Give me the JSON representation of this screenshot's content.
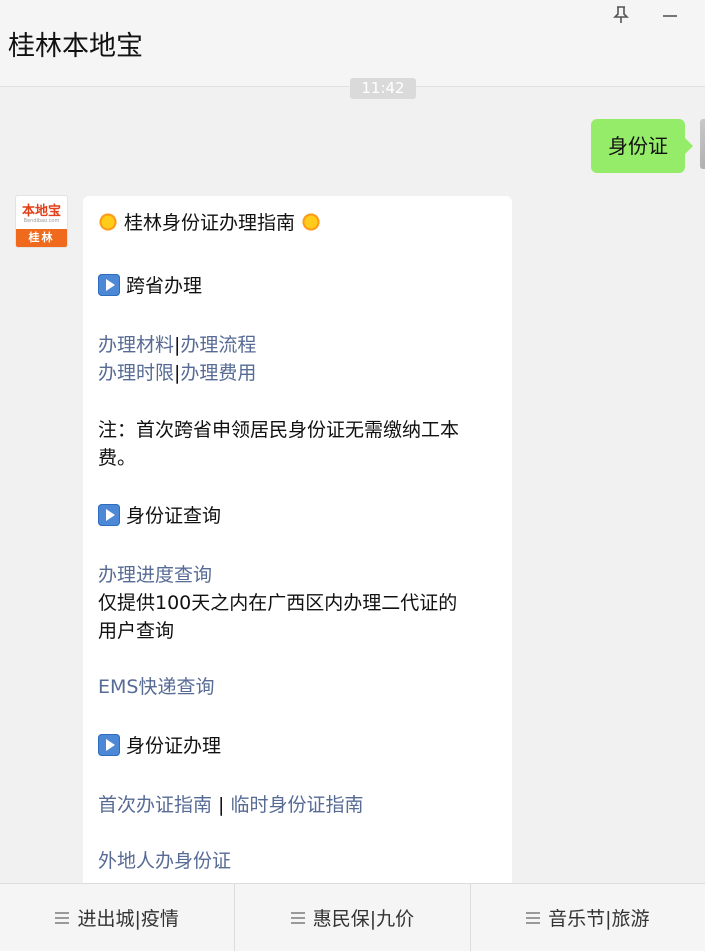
{
  "window": {
    "title": "桂林本地宝"
  },
  "chat": {
    "time": "11:42",
    "user_message": "身份证",
    "bot_avatar": {
      "logo_text": "本地宝",
      "logo_url": "Bendibao.com",
      "city": "桂林"
    },
    "bot_message": {
      "heading": "桂林身份证办理指南",
      "sec1_title": "跨省办理",
      "link_materials": "办理材料",
      "link_process": "办理流程",
      "link_time": "办理时限",
      "link_fee": "办理费用",
      "separator": "|",
      "note1": "注：首次跨省申领居民身份证无需缴纳工本",
      "note2": "费。",
      "sec2_title": "身份证查询",
      "link_progress": "办理进度查询",
      "progress_desc1": "仅提供100天之内在广西区内办理二代证的",
      "progress_desc2": "用户查询",
      "link_ems": "EMS快递查询",
      "sec3_title": "身份证办理",
      "link_first": "首次办证指南",
      "separator_spaced": " | ",
      "link_temp": "临时身份证指南",
      "link_nonlocal": "外地人办身份证"
    }
  },
  "menu": {
    "items": [
      {
        "label": "进出城|疫情"
      },
      {
        "label": "惠民保|九价"
      },
      {
        "label": "音乐节|旅游"
      }
    ]
  },
  "icons": {
    "pin": "pin-icon",
    "minimize": "minimize-icon",
    "menu": "menu-lines-icon",
    "sun": "sun-emoji-icon",
    "play": "play-button-icon"
  },
  "colors": {
    "link": "#576b95",
    "user_bubble": "#95ec69",
    "background": "#f1f1f1"
  }
}
